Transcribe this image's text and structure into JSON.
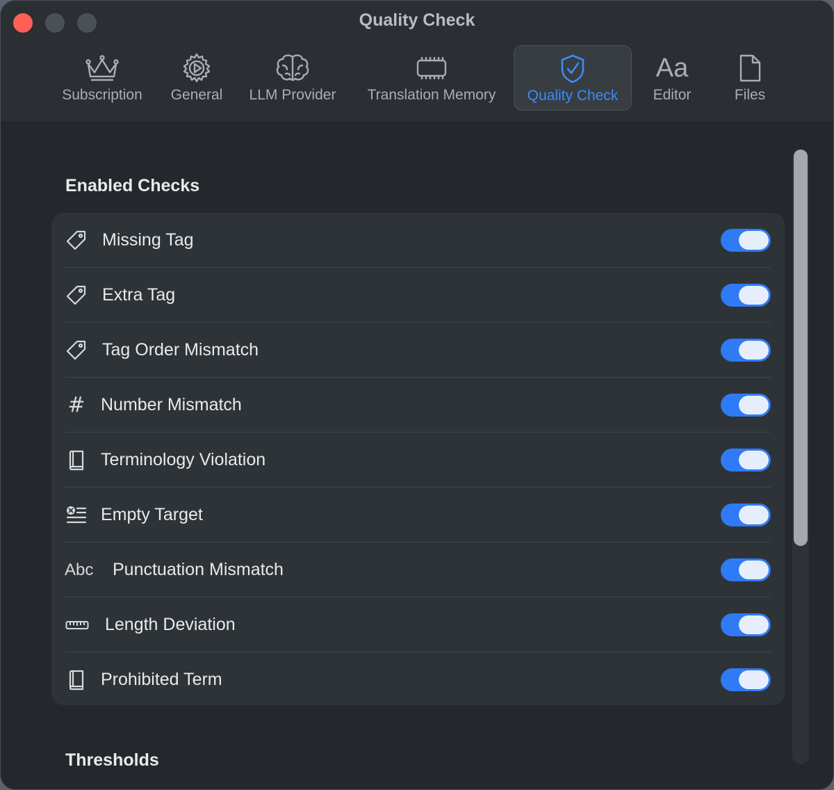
{
  "window": {
    "title": "Quality Check"
  },
  "tabs": [
    {
      "label": "Subscription",
      "icon": "crown-icon",
      "active": false
    },
    {
      "label": "General",
      "icon": "gear-icon",
      "active": false
    },
    {
      "label": "LLM Provider",
      "icon": "brain-icon",
      "active": false
    },
    {
      "label": "Translation Memory",
      "icon": "memory-chip-icon",
      "active": false
    },
    {
      "label": "Quality Check",
      "icon": "shield-check-icon",
      "active": true
    },
    {
      "label": "Editor",
      "icon": "text-format-icon",
      "glyph": "Aa",
      "active": false
    },
    {
      "label": "Files",
      "icon": "document-icon",
      "active": false
    }
  ],
  "sections": {
    "enabled_checks": "Enabled Checks",
    "thresholds": "Thresholds"
  },
  "checks": [
    {
      "label": "Missing Tag",
      "icon": "tag-icon",
      "enabled": true
    },
    {
      "label": "Extra Tag",
      "icon": "tag-icon",
      "enabled": true
    },
    {
      "label": "Tag Order Mismatch",
      "icon": "tag-icon",
      "enabled": true
    },
    {
      "label": "Number Mismatch",
      "icon": "number-sign-icon",
      "glyph": "#",
      "enabled": true
    },
    {
      "label": "Terminology Violation",
      "icon": "book-icon",
      "enabled": true
    },
    {
      "label": "Empty Target",
      "icon": "text-clear-icon",
      "enabled": true
    },
    {
      "label": "Punctuation Mismatch",
      "icon": "abc-text-icon",
      "glyph": "Abc",
      "enabled": true
    },
    {
      "label": "Length Deviation",
      "icon": "ruler-icon",
      "enabled": true
    },
    {
      "label": "Prohibited Term",
      "icon": "book-icon",
      "enabled": true
    }
  ],
  "colors": {
    "accent": "#2f7bf5",
    "active_tab_text": "#3b8cf6",
    "close_button": "#ff5f57",
    "background": "#24282c",
    "group_background": "#2e3337"
  }
}
